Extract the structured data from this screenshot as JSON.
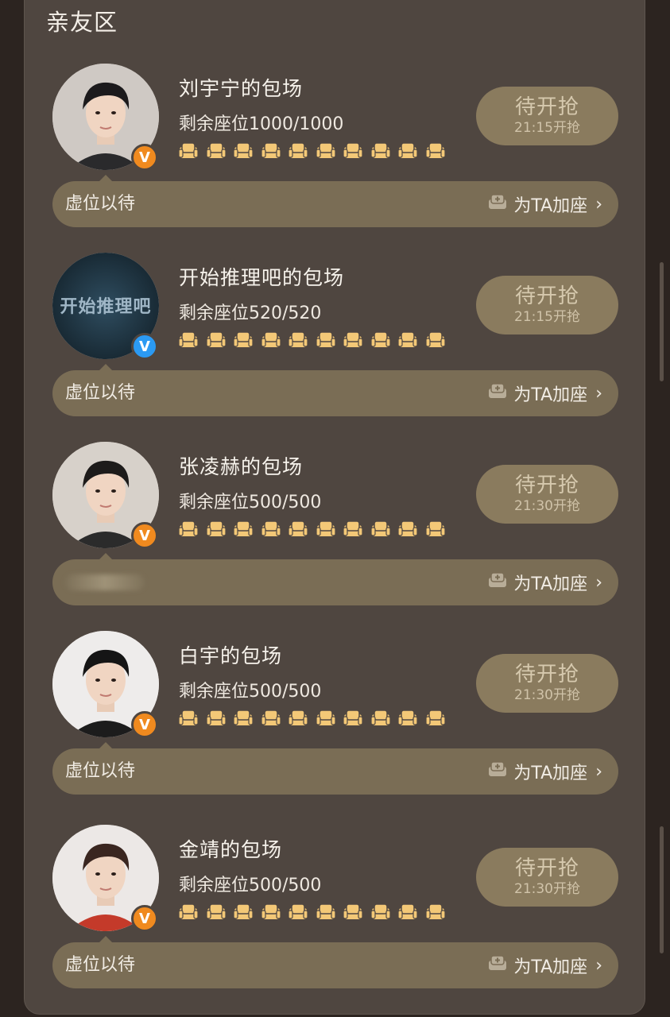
{
  "section": {
    "title": "亲友区"
  },
  "seat_icon": "sofa-seat-icon",
  "colors": {
    "seat": "#f3c877",
    "button": "#8a7b5e",
    "bar": "#7a6d55",
    "panel": "#4f4640"
  },
  "cards": [
    {
      "name": "刘宇宁的包场",
      "seats": "剩余座位1000/1000",
      "button_main": "待开抢",
      "button_time": "21:15开抢",
      "bar_left": "虚位以待",
      "bar_right": "为TA加座",
      "badge": "orange",
      "avatar": "person"
    },
    {
      "name": "开始推理吧的包场",
      "seats": "剩余座位520/520",
      "button_main": "待开抢",
      "button_time": "21:15开抢",
      "bar_left": "虚位以待",
      "bar_right": "为TA加座",
      "badge": "blue",
      "avatar": "logo",
      "avatar_logo_text": "开始推理吧"
    },
    {
      "name": "张凌赫的包场",
      "seats": "剩余座位500/500",
      "button_main": "待开抢",
      "button_time": "21:30开抢",
      "bar_left": "",
      "bar_right": "为TA加座",
      "badge": "orange",
      "avatar": "person"
    },
    {
      "name": "白宇的包场",
      "seats": "剩余座位500/500",
      "button_main": "待开抢",
      "button_time": "21:30开抢",
      "bar_left": "虚位以待",
      "bar_right": "为TA加座",
      "badge": "orange",
      "avatar": "person"
    },
    {
      "name": "金靖的包场",
      "seats": "剩余座位500/500",
      "button_main": "待开抢",
      "button_time": "21:30开抢",
      "bar_left": "虚位以待",
      "bar_right": "为TA加座",
      "badge": "orange",
      "avatar": "person"
    }
  ]
}
